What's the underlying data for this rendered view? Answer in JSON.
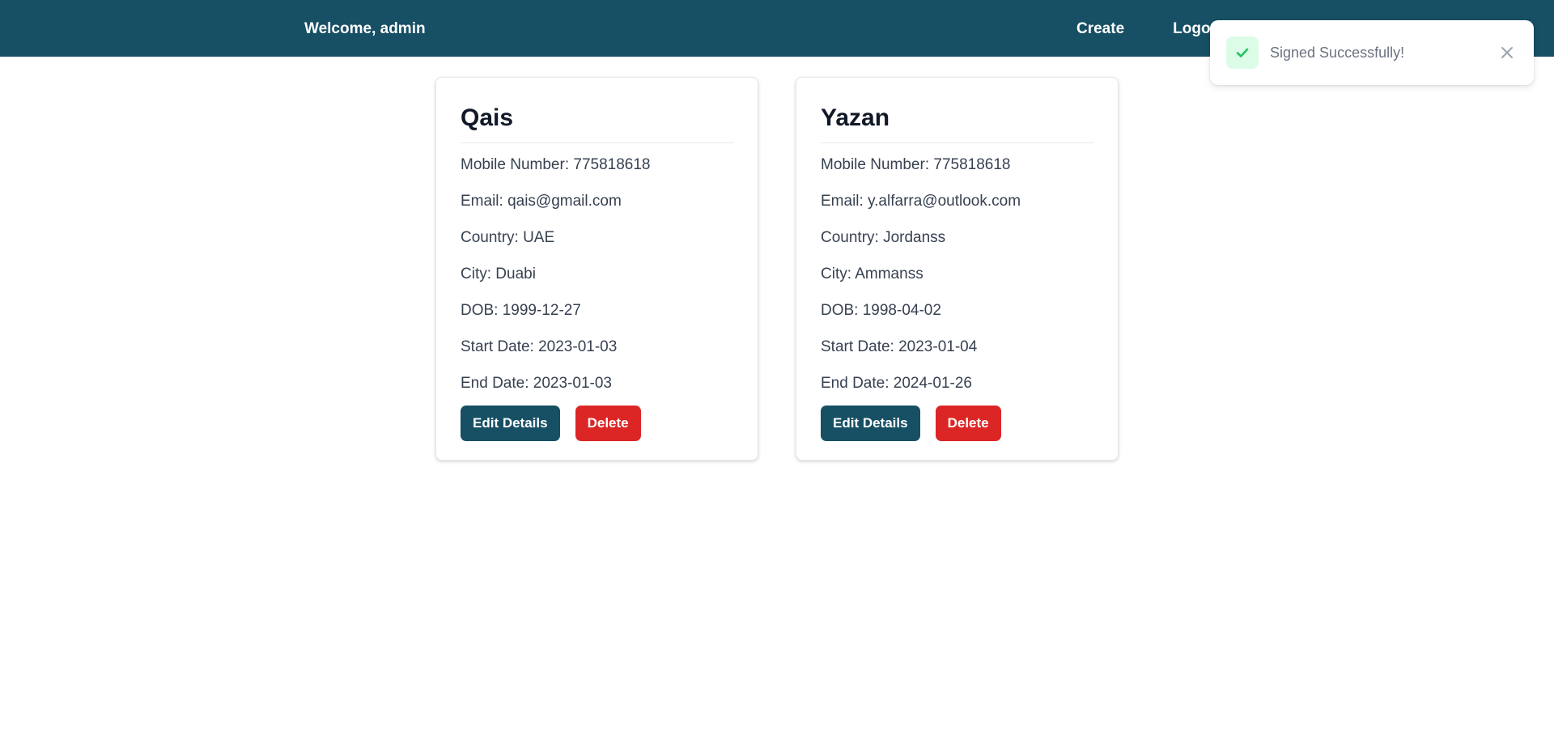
{
  "navbar": {
    "welcome": "Welcome, admin",
    "links": [
      {
        "label": "Create"
      },
      {
        "label": "Logout"
      }
    ],
    "background": "#174f64"
  },
  "cards": [
    {
      "name": "Qais",
      "fields": [
        "Mobile Number: 775818618",
        "Email: qais@gmail.com",
        "Country: UAE",
        "City: Duabi",
        "DOB: 1999-12-27",
        "Start Date: 2023-01-03",
        "End Date: 2023-01-03"
      ],
      "edit_label": "Edit Details",
      "delete_label": "Delete"
    },
    {
      "name": "Yazan",
      "fields": [
        "Mobile Number: 775818618",
        "Email: y.alfarra@outlook.com",
        "Country: Jordanss",
        "City: Ammanss",
        "DOB: 1998-04-02",
        "Start Date: 2023-01-04",
        "End Date: 2024-01-26"
      ],
      "edit_label": "Edit Details",
      "delete_label": "Delete"
    }
  ],
  "toast": {
    "message": "Signed Successfully!",
    "icon": "check-icon",
    "close_icon": "close-icon",
    "accent": "#22c55e"
  },
  "colors": {
    "primary": "#174f64",
    "danger": "#dc2626"
  }
}
